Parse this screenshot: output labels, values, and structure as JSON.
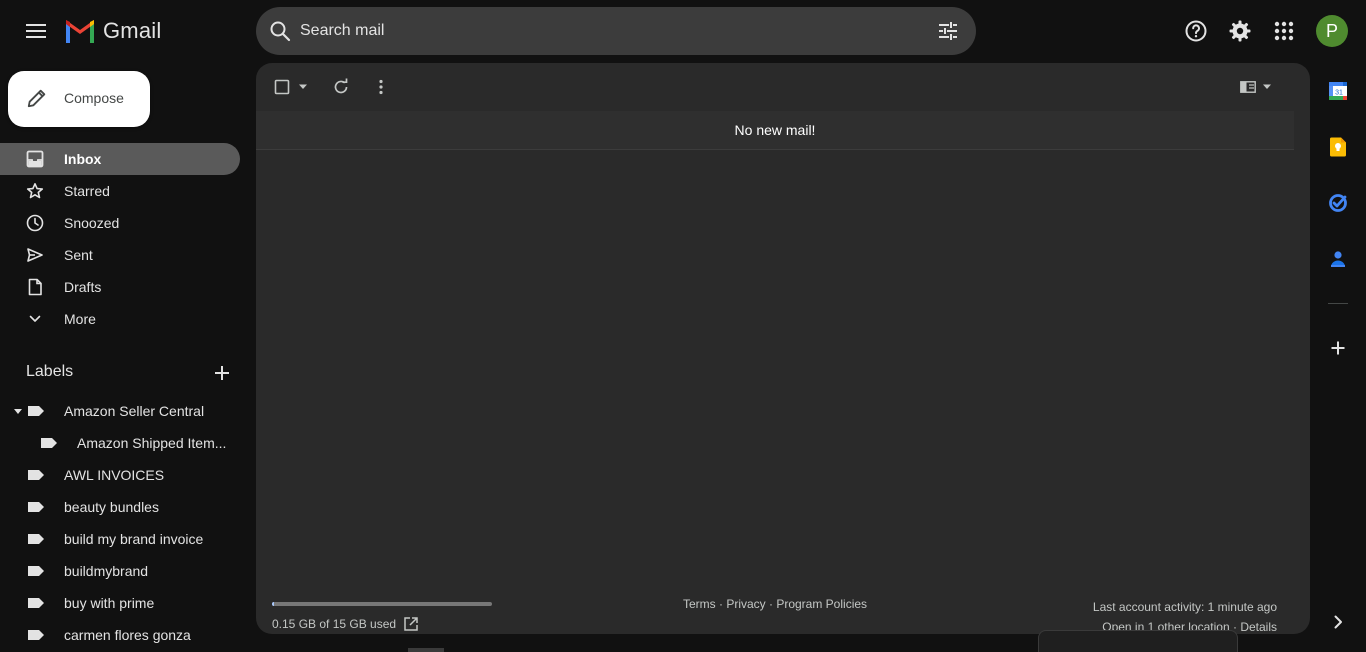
{
  "header": {
    "logo_text": "Gmail",
    "search_placeholder": "Search mail",
    "avatar_letter": "P"
  },
  "compose": {
    "label": "Compose"
  },
  "nav": [
    {
      "label": "Inbox",
      "icon": "inbox-icon",
      "active": true
    },
    {
      "label": "Starred",
      "icon": "star-icon"
    },
    {
      "label": "Snoozed",
      "icon": "clock-icon"
    },
    {
      "label": "Sent",
      "icon": "send-icon"
    },
    {
      "label": "Drafts",
      "icon": "draft-icon"
    },
    {
      "label": "More",
      "icon": "chevron-down-icon"
    }
  ],
  "labels": {
    "heading": "Labels",
    "items": [
      {
        "label": "Amazon Seller Central",
        "expanded": true
      },
      {
        "label": "Amazon Shipped Item...",
        "nested": true
      },
      {
        "label": "AWL INVOICES"
      },
      {
        "label": "beauty bundles"
      },
      {
        "label": "build my brand invoice"
      },
      {
        "label": "buildmybrand"
      },
      {
        "label": "buy with prime"
      },
      {
        "label": "carmen flores gonza"
      }
    ]
  },
  "main": {
    "notice": "No new mail!",
    "storage_text": "0.15 GB of 15 GB used",
    "storage_fraction": 0.01,
    "footer_links": "Terms · Privacy · Program Policies",
    "last_activity": "Last account activity: 1 minute ago",
    "other_location": "Open in 1 other location · Details"
  },
  "side_apps": [
    "calendar-icon",
    "keep-icon",
    "tasks-icon",
    "contacts-icon",
    "add-icon"
  ],
  "colors": {
    "background": "#111111",
    "panel": "#2a2a2a",
    "active_nav": "#5a5a5a",
    "avatar": "#4f8b2f",
    "accent_blue": "#a8c7fa"
  }
}
